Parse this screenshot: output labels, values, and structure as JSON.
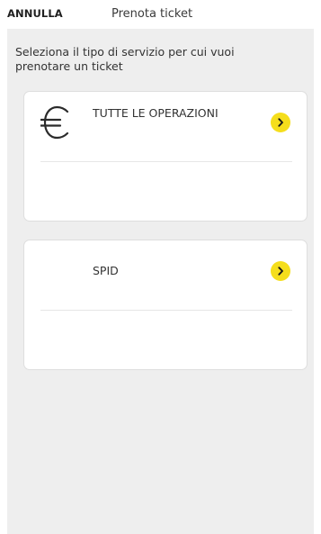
{
  "header": {
    "cancel_label": "ANNULLA",
    "title": "Prenota ticket"
  },
  "intro": {
    "text": "Seleziona il tipo di servizio per cui vuoi prenotare un ticket"
  },
  "services": [
    {
      "label": "TUTTE LE OPERAZIONI",
      "icon": "euro-icon"
    },
    {
      "label": "SPID",
      "icon": ""
    }
  ],
  "colors": {
    "accent": "#f5de1c",
    "background": "#eeeeee",
    "card": "#ffffff"
  }
}
